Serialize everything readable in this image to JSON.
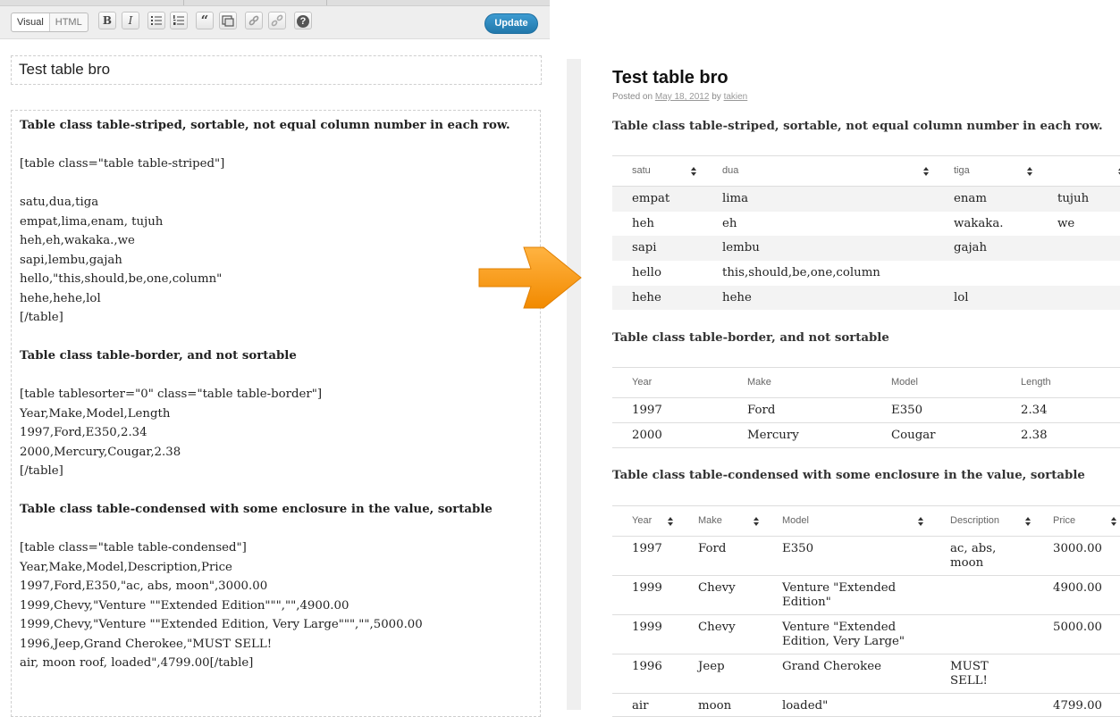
{
  "editor": {
    "mode_tabs": [
      "Visual",
      "HTML"
    ],
    "toolbar_buttons": [
      {
        "label": "B",
        "icon": "bold-icon"
      },
      {
        "label": "I",
        "icon": "italic-icon"
      },
      {
        "label": "",
        "icon": "unordered-list-icon"
      },
      {
        "label": "",
        "icon": "ordered-list-icon"
      },
      {
        "label": "“",
        "icon": "blockquote-icon"
      },
      {
        "label": "",
        "icon": "insert-media-icon"
      },
      {
        "label": "",
        "icon": "link-icon"
      },
      {
        "label": "",
        "icon": "unlink-icon"
      },
      {
        "label": "?",
        "icon": "help-icon"
      }
    ],
    "update_label": "Update",
    "title_value": "Test table bro",
    "body_lines": [
      {
        "text": "Table class table-striped, sortable, not equal column number in each row.",
        "bold": true
      },
      {
        "text": "",
        "bold": false
      },
      {
        "text": "[table class=\"table table-striped\"]",
        "bold": false
      },
      {
        "text": "",
        "bold": false
      },
      {
        "text": "satu,dua,tiga",
        "bold": false
      },
      {
        "text": "empat,lima,enam, tujuh",
        "bold": false
      },
      {
        "text": "heh,eh,wakaka.,we",
        "bold": false
      },
      {
        "text": "sapi,lembu,gajah",
        "bold": false
      },
      {
        "text": "hello,\"this,should,be,one,column\"",
        "bold": false
      },
      {
        "text": "hehe,hehe,lol",
        "bold": false
      },
      {
        "text": "[/table]",
        "bold": false
      },
      {
        "text": "",
        "bold": false
      },
      {
        "text": "Table class table-border, and not sortable",
        "bold": true
      },
      {
        "text": "",
        "bold": false
      },
      {
        "text": "[table tablesorter=\"0\" class=\"table table-border\"]",
        "bold": false
      },
      {
        "text": "Year,Make,Model,Length",
        "bold": false
      },
      {
        "text": "1997,Ford,E350,2.34",
        "bold": false
      },
      {
        "text": "2000,Mercury,Cougar,2.38",
        "bold": false
      },
      {
        "text": "[/table]",
        "bold": false
      },
      {
        "text": "",
        "bold": false
      },
      {
        "text": "Table class table-condensed with some enclosure in the value, sortable",
        "bold": true
      },
      {
        "text": "",
        "bold": false
      },
      {
        "text": "[table class=\"table table-condensed\"]",
        "bold": false
      },
      {
        "text": "Year,Make,Model,Description,Price",
        "bold": false
      },
      {
        "text": "1997,Ford,E350,\"ac, abs, moon\",3000.00",
        "bold": false
      },
      {
        "text": "1999,Chevy,\"Venture \"\"Extended Edition\"\"\",\"\",4900.00",
        "bold": false
      },
      {
        "text": "1999,Chevy,\"Venture \"\"Extended Edition, Very Large\"\"\",\"\",5000.00",
        "bold": false
      },
      {
        "text": "1996,Jeep,Grand Cherokee,\"MUST SELL!",
        "bold": false
      },
      {
        "text": "air, moon roof, loaded\",4799.00[/table]",
        "bold": false
      }
    ]
  },
  "preview": {
    "title": "Test table bro",
    "meta_prefix": "Posted on",
    "meta_date": "May 18, 2012",
    "meta_by": "by",
    "meta_author": "takien",
    "table1": {
      "heading": "Table class table-striped, sortable, not equal column number in each row.",
      "headers": [
        "satu",
        "dua",
        "tiga",
        ""
      ],
      "rows": [
        [
          "empat",
          "lima",
          "enam",
          "tujuh"
        ],
        [
          "heh",
          "eh",
          "wakaka.",
          "we"
        ],
        [
          "sapi",
          "lembu",
          "gajah",
          ""
        ],
        [
          "hello",
          "this,should,be,one,column",
          "",
          ""
        ],
        [
          "hehe",
          "hehe",
          "lol",
          ""
        ]
      ]
    },
    "table2": {
      "heading": "Table class table-border, and not sortable",
      "headers": [
        "Year",
        "Make",
        "Model",
        "Length"
      ],
      "rows": [
        [
          "1997",
          "Ford",
          "E350",
          "2.34"
        ],
        [
          "2000",
          "Mercury",
          "Cougar",
          "2.38"
        ]
      ]
    },
    "table3": {
      "heading": "Table class table-condensed with some enclosure in the value, sortable",
      "headers": [
        "Year",
        "Make",
        "Model",
        "Description",
        "Price"
      ],
      "rows": [
        [
          "1997",
          "Ford",
          "E350",
          "ac, abs,\nmoon",
          "3000.00"
        ],
        [
          "1999",
          "Chevy",
          "Venture \"Extended\nEdition\"",
          "",
          "4900.00"
        ],
        [
          "1999",
          "Chevy",
          "Venture \"Extended\nEdition, Very Large\"",
          "",
          "5000.00"
        ],
        [
          "1996",
          "Jeep",
          "Grand Cherokee",
          "MUST\nSELL!",
          ""
        ],
        [
          "air",
          "moon",
          "loaded\"",
          "",
          "4799.00"
        ]
      ]
    }
  }
}
